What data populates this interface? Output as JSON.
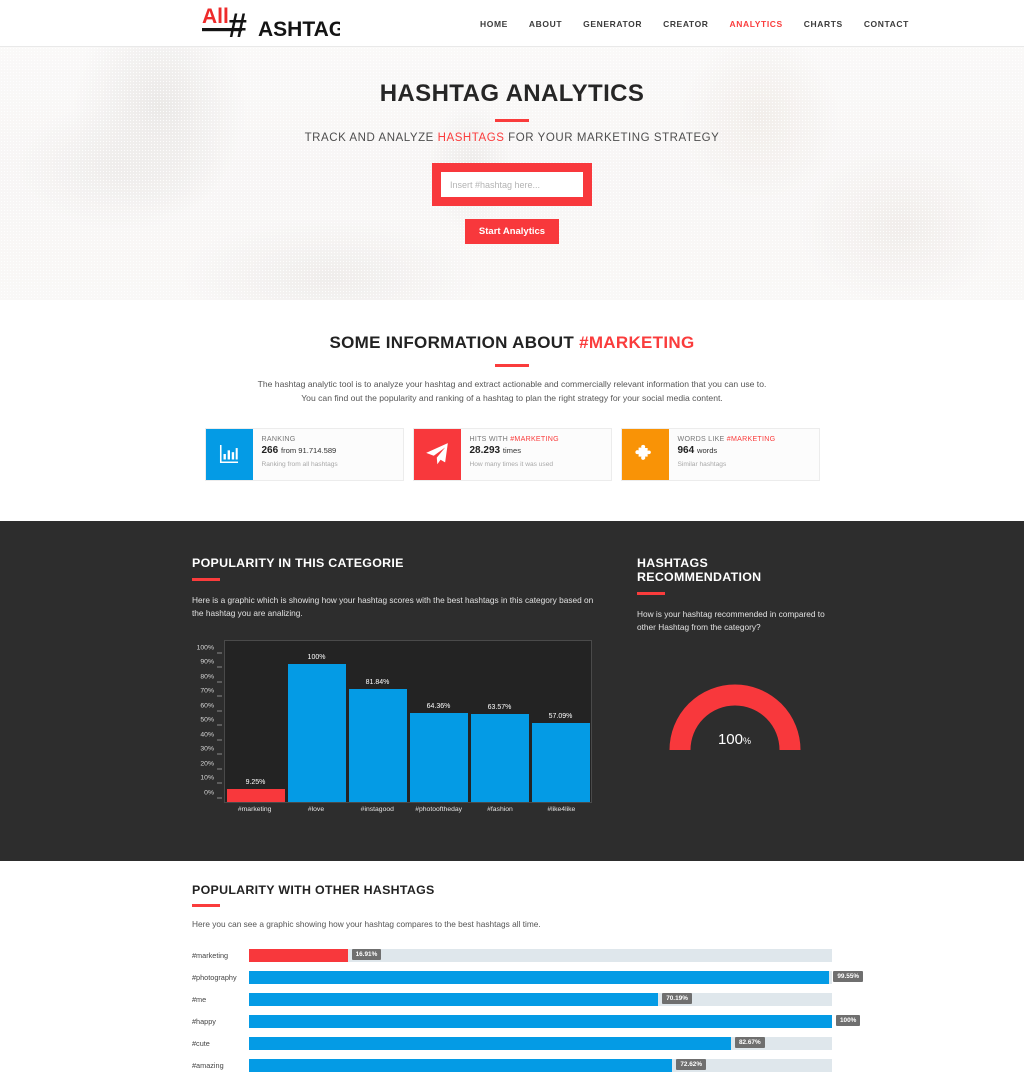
{
  "header": {
    "logo": {
      "part1": "All",
      "part2": "#",
      "part3": "ASHTAG"
    },
    "nav": [
      {
        "label": "HOME",
        "active": false
      },
      {
        "label": "ABOUT",
        "active": false
      },
      {
        "label": "GENERATOR",
        "active": false
      },
      {
        "label": "CREATOR",
        "active": false
      },
      {
        "label": "ANALYTICS",
        "active": true
      },
      {
        "label": "CHARTS",
        "active": false
      },
      {
        "label": "CONTACT",
        "active": false
      }
    ]
  },
  "hero": {
    "title": "HASHTAG ANALYTICS",
    "subtitle_before": "TRACK AND ANALYZE ",
    "subtitle_highlight": "HASHTAGS",
    "subtitle_after": " FOR YOUR MARKETING STRATEGY",
    "input_value": "",
    "input_placeholder": "Insert #hashtag here...",
    "button_label": "Start Analytics"
  },
  "info": {
    "title_before": "SOME INFORMATION ABOUT ",
    "title_highlight": "#MARKETING",
    "desc_line1": "The hashtag analytic tool is to analyze your hashtag and extract actionable and commercially relevant information that you can use to.",
    "desc_line2": "You can find out the popularity and ranking of a hashtag to plan the right strategy for your social media content.",
    "cards": [
      {
        "icon": "bar-chart-icon",
        "color": "#049be5",
        "label": "RANKING",
        "label_highlight": "",
        "value": "266",
        "unit": "from 91.714.589",
        "note": "Ranking from all hashtags"
      },
      {
        "icon": "paper-plane-icon",
        "color": "#f8383c",
        "label": "HITS WITH ",
        "label_highlight": "#MARKETING",
        "value": "28.293",
        "unit": "times",
        "note": "How many times it was used"
      },
      {
        "icon": "puzzle-icon",
        "color": "#f99306",
        "label": "WORDS LIKE ",
        "label_highlight": "#MARKETING",
        "value": "964",
        "unit": "words",
        "note": "Similar hashtags"
      }
    ]
  },
  "popularity_category": {
    "title": "POPULARITY IN THIS CATEGORIE",
    "desc": "Here is a graphic which is showing how your hashtag scores with the best hashtags in this category based on the hashtag you are analizing."
  },
  "recommendation": {
    "title": "HASHTAGS RECOMMENDATION",
    "desc": "How is your hashtag recommended in compared to other Hashtag from the category?",
    "value": "100",
    "unit": "%",
    "percent": 100,
    "color": "#f8383c"
  },
  "popularity_other": {
    "title": "POPULARITY WITH OTHER HASHTAGS",
    "desc": "Here you can see a graphic showing how your hashtag compares to the best hashtags all time."
  },
  "chart_data": [
    {
      "type": "bar",
      "title": "POPULARITY IN THIS CATEGORIE",
      "orientation": "vertical",
      "categories": [
        "#marketing",
        "#love",
        "#instagood",
        "#photooftheday",
        "#fashion",
        "#like4like"
      ],
      "values": [
        9.25,
        100,
        81.84,
        64.36,
        63.57,
        57.09
      ],
      "value_labels": [
        "9.25%",
        "100%",
        "81.84%",
        "64.36%",
        "63.57%",
        "57.09%"
      ],
      "colors": [
        "#f8383c",
        "#049be5",
        "#049be5",
        "#049be5",
        "#049be5",
        "#049be5"
      ],
      "ylabel": "",
      "xlabel": "",
      "ylim": [
        0,
        100
      ],
      "yticks": [
        0,
        10,
        20,
        30,
        40,
        50,
        60,
        70,
        80,
        90,
        100
      ],
      "ytick_labels": [
        "0%",
        "10%",
        "20%",
        "30%",
        "40%",
        "50%",
        "60%",
        "70%",
        "80%",
        "90%",
        "100%"
      ],
      "grid": false,
      "legend": "none"
    },
    {
      "type": "bar",
      "title": "POPULARITY WITH OTHER HASHTAGS",
      "orientation": "horizontal",
      "categories": [
        "#marketing",
        "#photography",
        "#me",
        "#happy",
        "#cute",
        "#amazing"
      ],
      "values": [
        16.91,
        99.55,
        70.19,
        100,
        82.67,
        72.62
      ],
      "value_labels": [
        "16.91%",
        "99.55%",
        "70.19%",
        "100%",
        "82.67%",
        "72.62%"
      ],
      "colors": [
        "#f8383c",
        "#049be5",
        "#049be5",
        "#049be5",
        "#049be5",
        "#049be5"
      ],
      "xlim": [
        0,
        100
      ],
      "grid": false,
      "legend": "none"
    }
  ]
}
